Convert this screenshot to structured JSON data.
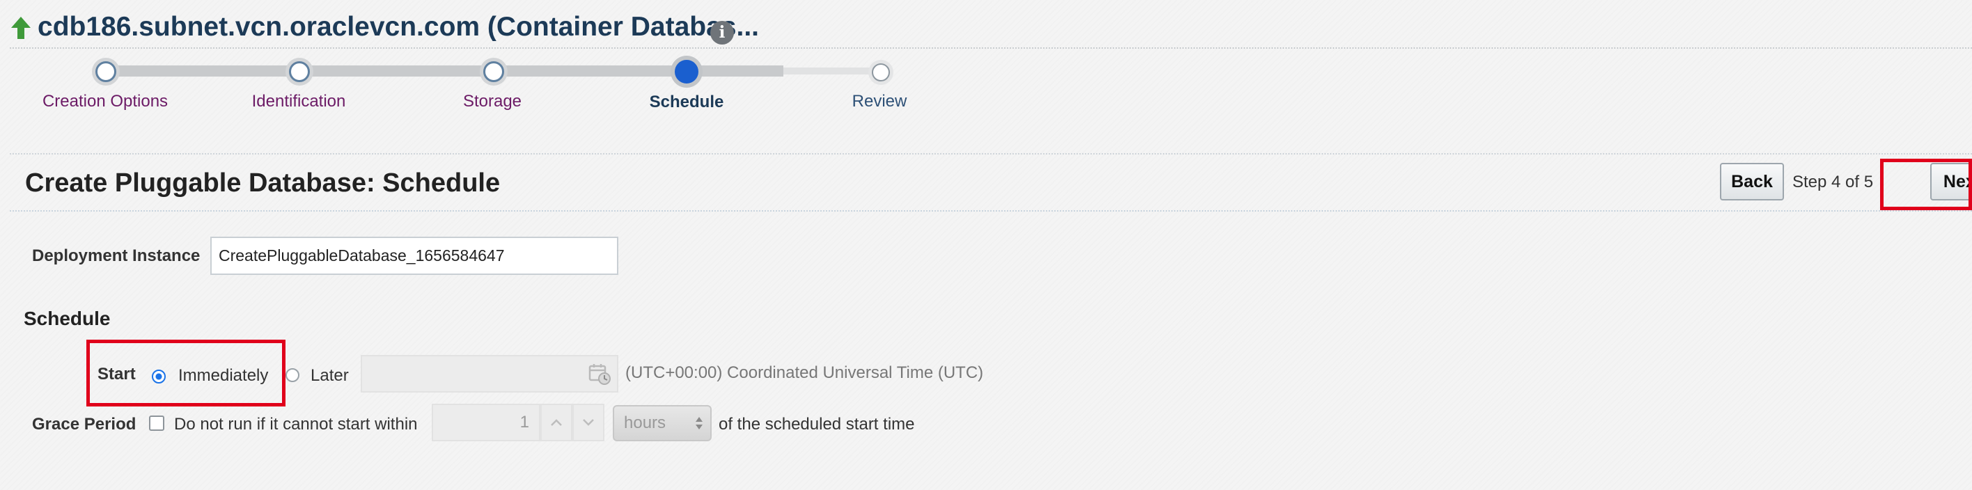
{
  "header": {
    "title": "cdb186.subnet.vcn.oraclevcn.com (Container Databas...",
    "info_icon": "info-icon",
    "arrow_icon": "up-arrow-icon"
  },
  "train": {
    "steps": [
      {
        "label": "Creation Options",
        "state": "visited"
      },
      {
        "label": "Identification",
        "state": "visited"
      },
      {
        "label": "Storage",
        "state": "visited"
      },
      {
        "label": "Schedule",
        "state": "current"
      },
      {
        "label": "Review",
        "state": "future"
      }
    ]
  },
  "page": {
    "title": "Create Pluggable Database: Schedule",
    "back_label": "Back",
    "step_text": "Step 4 of 5",
    "next_label": "Next"
  },
  "form": {
    "deployment_label": "Deployment Instance",
    "deployment_value": "CreatePluggableDatabase_1656584647",
    "schedule_heading": "Schedule",
    "start_label": "Start",
    "immediately_label": "Immediately",
    "later_label": "Later",
    "timezone": "(UTC+00:00) Coordinated Universal Time (UTC)",
    "grace_label": "Grace Period",
    "grace_checkbox_label": "Do not run if it cannot start within",
    "grace_value": "1",
    "grace_unit": "hours",
    "grace_suffix": "of the scheduled start time"
  },
  "colors": {
    "accent": "#1a5fcf",
    "highlight": "#e0001b",
    "title": "#1c3a57",
    "visited_step": "#6c1b66"
  }
}
